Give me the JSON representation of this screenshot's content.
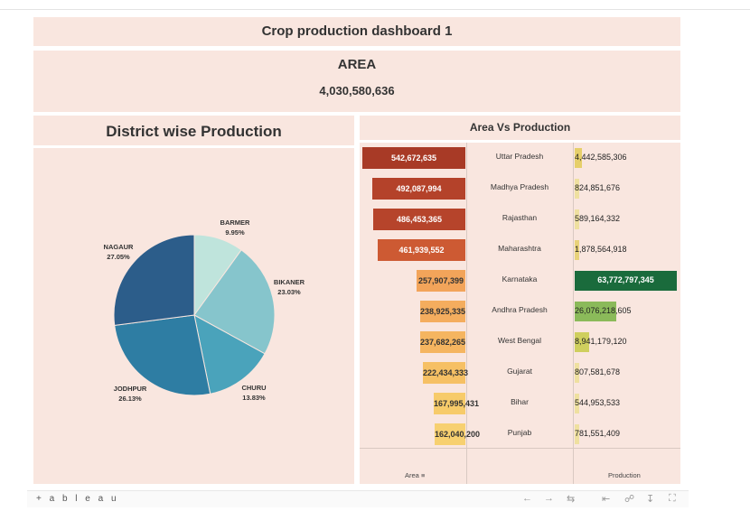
{
  "dashboard": {
    "title": "Crop production dashboard 1"
  },
  "area_kpi": {
    "label": "AREA",
    "value": "4,030,580,636"
  },
  "pie": {
    "title": "District wise Production",
    "slices": [
      {
        "name": "BARMER",
        "pct": "9.95%",
        "value": 9.95,
        "color": "#bfe4dc"
      },
      {
        "name": "BIKANER",
        "pct": "23.03%",
        "value": 23.03,
        "color": "#86c5cc"
      },
      {
        "name": "CHURU",
        "pct": "13.83%",
        "value": 13.83,
        "color": "#4aa3bb"
      },
      {
        "name": "JODHPUR",
        "pct": "26.13%",
        "value": 26.13,
        "color": "#2e7da3"
      },
      {
        "name": "NAGAUR",
        "pct": "27.05%",
        "value": 27.05,
        "color": "#2c5d8a"
      }
    ]
  },
  "avp": {
    "title": "Area Vs Production",
    "footer_area": "Area",
    "footer_production": "Production",
    "rows": [
      {
        "state": "Uttar Pradesh",
        "area": "542,672,635",
        "area_val": 542672635,
        "area_color": "#a83a26",
        "prod": "4,442,585,306",
        "prod_val": 4442585306,
        "prod_color": "#e6cf6a"
      },
      {
        "state": "Madhya Pradesh",
        "area": "492,087,994",
        "area_val": 492087994,
        "area_color": "#b4422a",
        "prod": "824,851,676",
        "prod_val": 824851676,
        "prod_color": "#efe0a0"
      },
      {
        "state": "Rajasthan",
        "area": "486,453,365",
        "area_val": 486453365,
        "area_color": "#b6442b",
        "prod": "589,164,332",
        "prod_val": 589164332,
        "prod_color": "#efe0a0"
      },
      {
        "state": "Maharashtra",
        "area": "461,939,552",
        "area_val": 461939552,
        "area_color": "#cd5a33",
        "prod": "1,878,564,918",
        "prod_val": 1878564918,
        "prod_color": "#e8d27a"
      },
      {
        "state": "Karnataka",
        "area": "257,907,399",
        "area_val": 257907399,
        "area_color": "#f2a45a",
        "prod": "63,772,797,345",
        "prod_val": 63772797345,
        "prod_color": "#1a6b3c"
      },
      {
        "state": "Andhra Pradesh",
        "area": "238,925,335",
        "area_val": 238925335,
        "area_color": "#f4ad5e",
        "prod": "26,076,218,605",
        "prod_val": 26076218605,
        "prod_color": "#8bba5a"
      },
      {
        "state": "West Bengal",
        "area": "237,682,265",
        "area_val": 237682265,
        "area_color": "#f5b560",
        "prod": "8,941,179,120",
        "prod_val": 8941179120,
        "prod_color": "#cfcf5e"
      },
      {
        "state": "Gujarat",
        "area": "222,434,333",
        "area_val": 222434333,
        "area_color": "#f6c064",
        "prod": "807,581,678",
        "prod_val": 807581678,
        "prod_color": "#efe0a0"
      },
      {
        "state": "Bihar",
        "area": "167,995,431",
        "area_val": 167995431,
        "area_color": "#f7cb6a",
        "prod": "544,953,533",
        "prod_val": 544953533,
        "prod_color": "#efe0a0"
      },
      {
        "state": "Punjab",
        "area": "162,040,200",
        "area_val": 162040200,
        "area_color": "#f7d070",
        "prod": "781,551,409",
        "prod_val": 781551409,
        "prod_color": "#efe0a0"
      }
    ]
  },
  "toolbar": {
    "logo": "+ a b l e a u",
    "icons": [
      "undo-icon",
      "redo-icon",
      "revert-icon",
      "pause-icon",
      "share-icon",
      "download-icon",
      "fullscreen-icon"
    ]
  }
}
